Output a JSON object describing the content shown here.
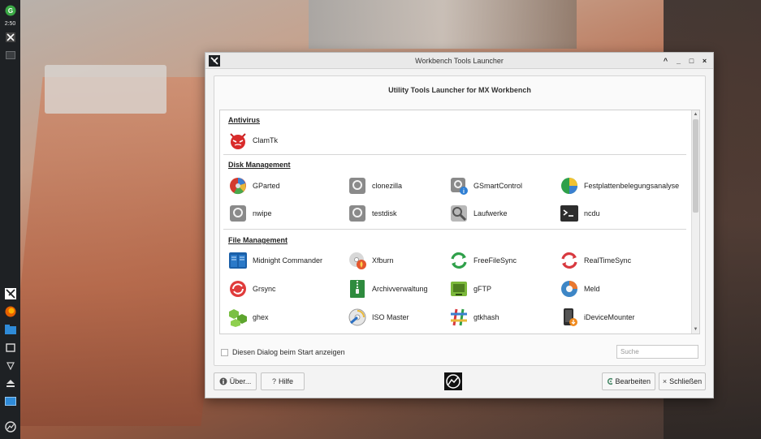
{
  "panel": {
    "time": "2:50"
  },
  "window": {
    "title": "Workbench Tools Launcher",
    "controls": {
      "shade": "^",
      "minimize": "_",
      "maximize": "□",
      "close": "×"
    },
    "heading": "Utility Tools Launcher for MX Workbench"
  },
  "categories": {
    "antivirus": "Antivirus",
    "disk": "Disk Management",
    "file": "File Management"
  },
  "tools": {
    "clamtk": "ClamTk",
    "gparted": "GParted",
    "clonezilla": "clonezilla",
    "gsmartcontrol": "GSmartControl",
    "festplatten": "Festplattenbelegungsanalyse",
    "nwipe": "nwipe",
    "testdisk": "testdisk",
    "laufwerke": "Laufwerke",
    "ncdu": "ncdu",
    "mc": "Midnight Commander",
    "xfburn": "Xfburn",
    "freefilesync": "FreeFileSync",
    "realtimesync": "RealTimeSync",
    "grsync": "Grsync",
    "archiv": "Archivverwaltung",
    "gftp": "gFTP",
    "meld": "Meld",
    "ghex": "ghex",
    "isomaster": "ISO Master",
    "gtkhash": "gtkhash",
    "idevicemounter": "iDeviceMounter"
  },
  "footer": {
    "startup_checkbox": "Diesen Dialog beim Start anzeigen",
    "search_placeholder": "Suche",
    "about": "Über...",
    "help": "Hilfe",
    "edit": "Bearbeiten",
    "close": "Schließen"
  },
  "colors": {
    "panel_bg": "#1e2124",
    "window_bg": "#f3f3f3",
    "clamtk_red": "#d92b2b",
    "accent_green": "#3aa845"
  },
  "icons": {
    "about": "info-circle-icon",
    "help": "question-icon",
    "edit": "gear-icon",
    "close": "x-icon"
  }
}
